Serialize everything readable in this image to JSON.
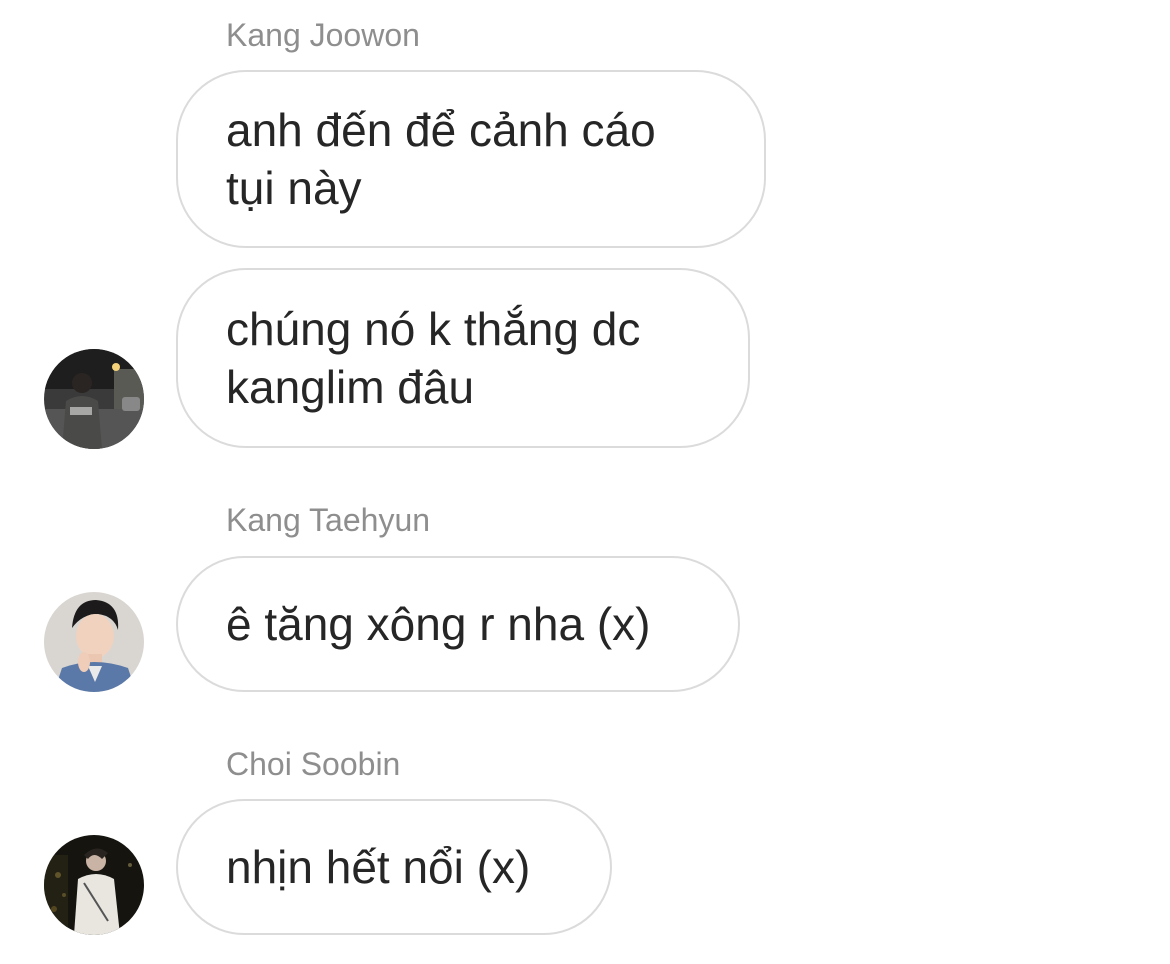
{
  "messages": [
    {
      "sender": "Kang Joowon",
      "bubbles": [
        {
          "text": "anh đến để cảnh cáo\ntụi này"
        },
        {
          "text": "chúng nó k thắng dc\nkanglim đâu"
        }
      ],
      "avatar": "street-photo-avatar"
    },
    {
      "sender": "Kang Taehyun",
      "bubbles": [
        {
          "text": "ê tăng xông r nha (x)"
        }
      ],
      "avatar": "portrait-avatar"
    },
    {
      "sender": "Choi Soobin",
      "bubbles": [
        {
          "text": "nhịn hết nổi (x)"
        }
      ],
      "avatar": "night-photo-avatar"
    }
  ],
  "colors": {
    "bubble_border": "#dbdbdb",
    "sender_name": "#8e8e8e",
    "message_text": "#262626",
    "background": "#ffffff"
  }
}
